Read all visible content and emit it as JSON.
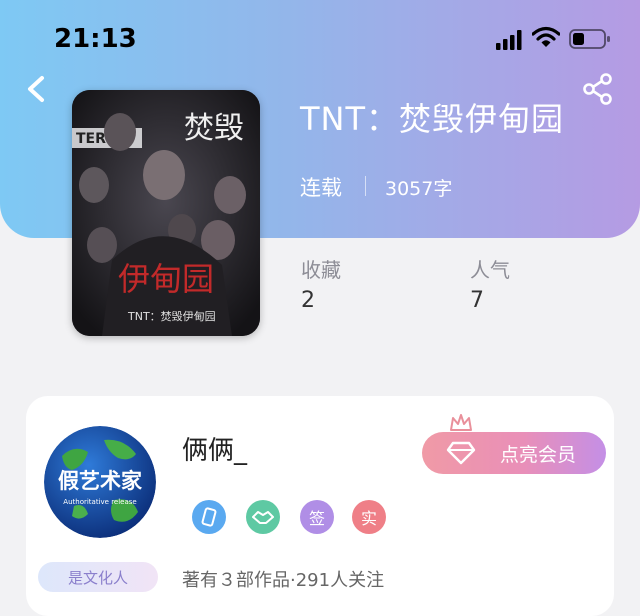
{
  "status_bar": {
    "time": "21:13"
  },
  "book": {
    "title": "TNT：焚毁伊甸园",
    "status": "连载",
    "word_count": "3057字",
    "cover_text": "TNT：焚毁伊甸园"
  },
  "stats": {
    "favorites": {
      "label": "收藏",
      "value": "2"
    },
    "popularity": {
      "label": "人气",
      "value": "7"
    }
  },
  "author": {
    "name": "俩俩_",
    "avatar_text": "假艺术家",
    "avatar_subtext": "Authoritative release",
    "vip_button": "点亮会员",
    "badges": [
      "签",
      "实"
    ],
    "culture_tag": "是文化人",
    "works_info": "著有３部作品·291人关注"
  },
  "colors": {
    "header_start": "#7ec9f4",
    "header_end": "#b59be3",
    "vip_pink": "#f09aa6",
    "badge_blue": "#5aa9f0",
    "badge_green": "#5ec9a3",
    "badge_purple": "#b08ee6",
    "badge_red": "#ef7f87"
  }
}
